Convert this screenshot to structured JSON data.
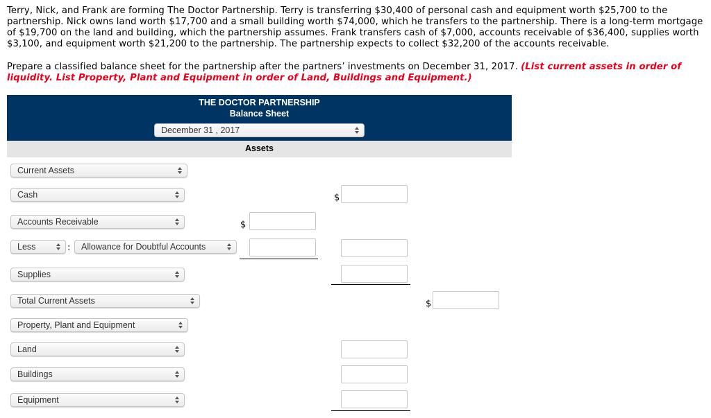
{
  "problem_text": "Terry, Nick, and Frank are forming The Doctor Partnership. Terry is transferring $30,400 of personal cash and equipment worth $25,700 to the partnership. Nick owns land worth $17,700 and a small building worth $74,000, which he transfers to the partnership. There is a long-term mortgage of $19,700 on the land and building, which the partnership assumes. Frank transfers cash of $7,000, accounts receivable of $36,400, supplies worth $3,100, and equipment worth $21,200 to the partnership. The partnership expects to collect $32,200 of the accounts receivable.",
  "instructions": {
    "text": "Prepare a classified balance sheet for the partnership after the partners’ investments on December 31, 2017. ",
    "note": "(List current assets in order of liquidity. List Property, Plant and Equipment in order of Land, Buildings and Equipment.)"
  },
  "sheet": {
    "company": "THE DOCTOR PARTNERSHIP",
    "title": "Balance Sheet",
    "date_select": "December 31 , 2017",
    "section": "Assets",
    "currency_symbol": "$",
    "rows": {
      "current_assets": "Current Assets",
      "cash": "Cash",
      "accounts_receivable": "Accounts Receivable",
      "less": "Less",
      "colon": ":",
      "allowance": "Allowance for Doubtful Accounts",
      "supplies": "Supplies",
      "total_current_assets": "Total Current Assets",
      "ppe": "Property, Plant and Equipment",
      "land": "Land",
      "buildings": "Buildings",
      "equipment": "Equipment"
    },
    "inputs": {
      "cash": "",
      "accounts_receivable": "",
      "allowance": "",
      "net_receivable": "",
      "supplies": "",
      "total_current_assets": "",
      "land": "",
      "buildings": "",
      "equipment": ""
    }
  }
}
